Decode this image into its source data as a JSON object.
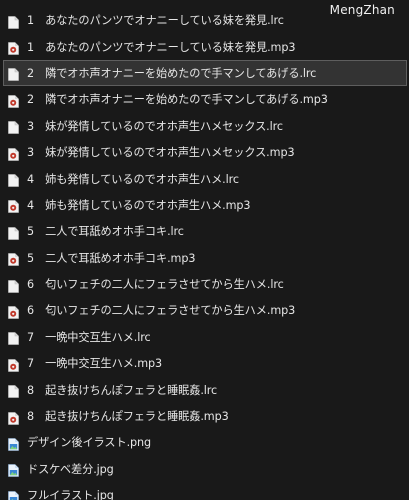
{
  "watermark": "MengZhan",
  "files": [
    {
      "name": "1　あなたのパンツでオナニーしている妹を発見.lrc",
      "icon": "document-icon",
      "selected": false
    },
    {
      "name": "1　あなたのパンツでオナニーしている妹を発見.mp3",
      "icon": "audio-file-icon",
      "selected": false
    },
    {
      "name": "2　隣でオホ声オナニーを始めたので手マンしてあげる.lrc",
      "icon": "document-icon",
      "selected": true
    },
    {
      "name": "2　隣でオホ声オナニーを始めたので手マンしてあげる.mp3",
      "icon": "audio-file-icon",
      "selected": false
    },
    {
      "name": "3　妹が発情しているのでオホ声生ハメセックス.lrc",
      "icon": "document-icon",
      "selected": false
    },
    {
      "name": "3　妹が発情しているのでオホ声生ハメセックス.mp3",
      "icon": "audio-file-icon",
      "selected": false
    },
    {
      "name": "4　姉も発情しているのでオホ声生ハメ.lrc",
      "icon": "document-icon",
      "selected": false
    },
    {
      "name": "4　姉も発情しているのでオホ声生ハメ.mp3",
      "icon": "audio-file-icon",
      "selected": false
    },
    {
      "name": "5　二人で耳舐めオホ手コキ.lrc",
      "icon": "document-icon",
      "selected": false
    },
    {
      "name": "5　二人で耳舐めオホ手コキ.mp3",
      "icon": "audio-file-icon",
      "selected": false
    },
    {
      "name": "6　匂いフェチの二人にフェラさせてから生ハメ.lrc",
      "icon": "document-icon",
      "selected": false
    },
    {
      "name": "6　匂いフェチの二人にフェラさせてから生ハメ.mp3",
      "icon": "audio-file-icon",
      "selected": false
    },
    {
      "name": "7　一晩中交互生ハメ.lrc",
      "icon": "document-icon",
      "selected": false
    },
    {
      "name": "7　一晩中交互生ハメ.mp3",
      "icon": "audio-file-icon",
      "selected": false
    },
    {
      "name": "8　起き抜けちんぽフェラと睡眠姦.lrc",
      "icon": "document-icon",
      "selected": false
    },
    {
      "name": "8　起き抜けちんぽフェラと睡眠姦.mp3",
      "icon": "audio-file-icon",
      "selected": false
    },
    {
      "name": "デザイン後イラスト.png",
      "icon": "image-file-icon",
      "selected": false
    },
    {
      "name": "ドスケベ差分.jpg",
      "icon": "image-file-icon",
      "selected": false
    },
    {
      "name": "フルイラスト.jpg",
      "icon": "image-file-icon",
      "selected": false
    }
  ]
}
